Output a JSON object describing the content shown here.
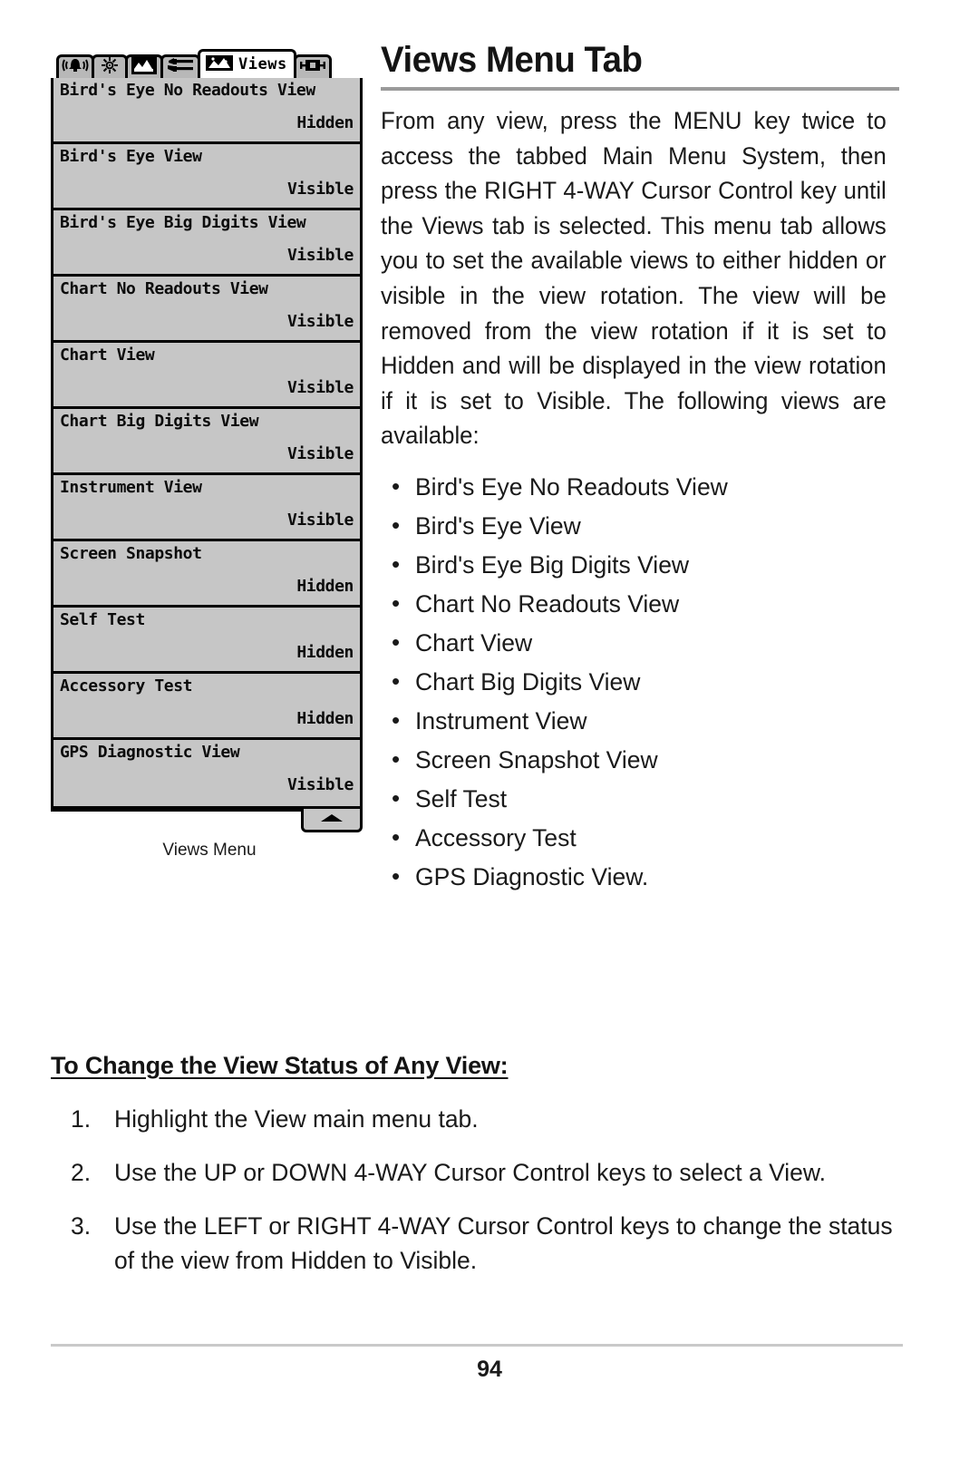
{
  "page": {
    "number": "94",
    "heading": "Views Menu Tab",
    "body_paragraph": "From any view, press the MENU key twice to access the tabbed Main Menu System, then press the RIGHT 4-WAY Cursor Control key until the Views tab is selected. This menu tab allows you to set the available views to either hidden or visible in the view rotation. The view will be removed from the view rotation if it is set to Hidden and will be displayed in the view rotation if it is set to Visible. The following views are available:",
    "available_views": [
      "Bird's Eye No Readouts View",
      "Bird's Eye View",
      "Bird's Eye Big Digits View",
      "Chart No Readouts View",
      "Chart View",
      "Chart Big Digits View",
      "Instrument View",
      "Screen Snapshot View",
      "Self Test",
      "Accessory Test",
      "GPS Diagnostic View."
    ],
    "procedure_heading": "To Change the View Status of Any View:",
    "procedure_steps": [
      {
        "num": "1.",
        "text": "Highlight the View main menu tab."
      },
      {
        "num": "2.",
        "text": "Use the UP or DOWN 4-WAY Cursor Control keys to select a View."
      },
      {
        "num": "3.",
        "text": "Use the LEFT or RIGHT 4-WAY Cursor Control keys to change the status of the view from Hidden to Visible."
      }
    ]
  },
  "figure": {
    "caption": "Views Menu",
    "tabs": [
      {
        "icon": "alarm-bell-icon",
        "label": "",
        "selected": false
      },
      {
        "icon": "sonar-sun-icon",
        "label": "",
        "selected": false
      },
      {
        "icon": "navigation-chart-icon",
        "label": "",
        "selected": false
      },
      {
        "icon": "setup-wrench-icon",
        "label": "",
        "selected": false
      },
      {
        "icon": "views-screen-icon",
        "label": "Views",
        "selected": true
      },
      {
        "icon": "accessory-icon",
        "label": "",
        "selected": false
      }
    ],
    "menu_rows": [
      {
        "name": "Bird's Eye No Readouts View",
        "value": "Hidden"
      },
      {
        "name": "Bird's Eye View",
        "value": "Visible"
      },
      {
        "name": "Bird's Eye Big Digits View",
        "value": "Visible"
      },
      {
        "name": "Chart No Readouts View",
        "value": "Visible"
      },
      {
        "name": "Chart View",
        "value": "Visible"
      },
      {
        "name": "Chart Big Digits View",
        "value": "Visible"
      },
      {
        "name": "Instrument View",
        "value": "Visible"
      },
      {
        "name": "Screen Snapshot",
        "value": "Hidden"
      },
      {
        "name": "Self Test",
        "value": "Hidden"
      },
      {
        "name": "Accessory Test",
        "value": "Hidden"
      },
      {
        "name": "GPS Diagnostic View",
        "value": "Visible"
      }
    ],
    "scroll_indicator": "scroll-up-arrow-icon"
  },
  "colors": {
    "lcd_background": "#c6c6c6",
    "lcd_border": "#000000",
    "tab_background": "#b8b8b8",
    "selected_tab_background": "#ffffff",
    "heading_rule": "#9a9a9a",
    "footer_rule": "#c9c9c9",
    "text": "#1a1a1a"
  }
}
